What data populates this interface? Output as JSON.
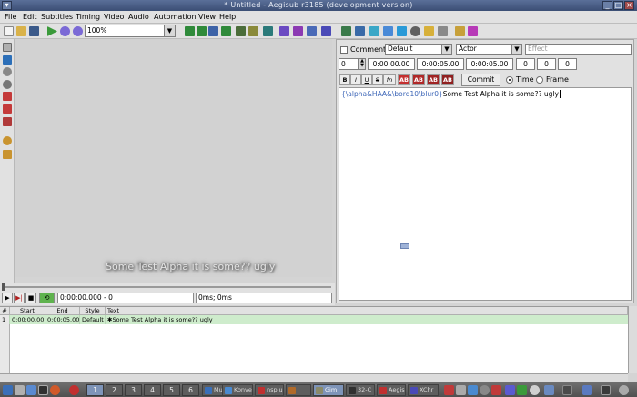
{
  "window": {
    "title": "* Untitled - Aegisub r3185 (development version)",
    "minimize": "_",
    "maximize": "□",
    "close": "×"
  },
  "menu": [
    "File",
    "Edit",
    "Subtitles",
    "Timing",
    "Video",
    "Audio",
    "Automation",
    "View",
    "Help"
  ],
  "toolbar": {
    "zoom_value": "100%"
  },
  "video": {
    "subtitle_preview": "Some Test Alpha it is some?? ugly",
    "time_field": "0:00:00.000 - 0",
    "offset_field": "0ms; 0ms"
  },
  "edit": {
    "comment_label": "Comment",
    "style_value": "Default",
    "actor_value": "Actor",
    "effect_placeholder": "Effect",
    "layer_value": "0",
    "start_time": "0:00:00.00",
    "end_time": "0:00:05.00",
    "duration": "0:00:05.00",
    "margin_l": "0",
    "margin_r": "0",
    "margin_v": "0",
    "format_buttons": [
      "B",
      "I",
      "U",
      "S",
      "fn",
      "AB",
      "AB",
      "AB",
      "AB"
    ],
    "commit_label": "Commit",
    "time_label": "Time",
    "frame_label": "Frame",
    "text_tags": "{\\alpha&HAA&\\bord10\\blur0}",
    "text_body": "Some Test Alpha it is some?? ugly"
  },
  "grid": {
    "headers": [
      "#",
      "Start",
      "End",
      "Style",
      "Text"
    ],
    "rows": [
      {
        "num": "1",
        "start": "0:00:00.00",
        "end": "0:00:05.00",
        "style": "Default",
        "text": "✱Some Test Alpha it is some?? ugly"
      }
    ]
  },
  "taskbar": {
    "workspaces": [
      "1",
      "2",
      "3",
      "4",
      "5",
      "6"
    ],
    "tasks": [
      "Music",
      "Konve",
      "nsplu",
      "",
      "Gim",
      "32-C",
      "Aegis",
      "XChr"
    ]
  },
  "colors": {
    "title_bg": "#4a5f88",
    "grid_selected": "#ceeccc",
    "tag_color": "#3e67b8"
  }
}
